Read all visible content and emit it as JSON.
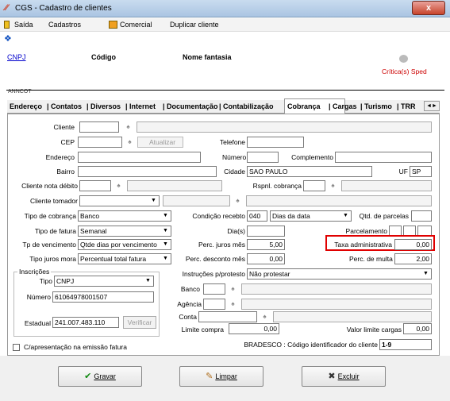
{
  "window": {
    "title": "CGS - Cadastro de clientes",
    "close": "x"
  },
  "menu": {
    "exit": "Saída",
    "cadastros": "Cadastros",
    "comercial": "Comercial",
    "duplicate": "Duplicar cliente"
  },
  "header": {
    "cnpj": "CNPJ",
    "codigo": "Código",
    "nome_fantasia": "Nome fantasia",
    "sped": "Crítica(s) Sped",
    "fragment": "ANNCOT"
  },
  "tabs": [
    "Endereço",
    "Contatos",
    "Diversos",
    "Internet",
    "Documentação",
    "Contabilização",
    "Cobrança",
    "Cargas",
    "Turismo",
    "TRR"
  ],
  "tab_arrows": "◄►",
  "form": {
    "cliente": "Cliente",
    "cep": "CEP",
    "atualizar": "Atualizar",
    "telefone": "Telefone",
    "endereco": "Endereço",
    "numero": "Número",
    "complemento": "Complemento",
    "bairro": "Bairro",
    "cidade": "Cidade",
    "cidade_val": "SAO PAULO",
    "uf": "UF",
    "uf_val": "SP",
    "cliente_nota": "Cliente nota débito",
    "rspnl": "Rspnl. cobrança",
    "cliente_tomador": "Cliente tomador",
    "tipo_cobranca": "Tipo de cobrança",
    "tipo_cobranca_val": "Banco",
    "cond_recebto": "Condição recebto",
    "cond_code": "040",
    "cond_val": "Dias da data",
    "qtd_parcelas": "Qtd. de parcelas",
    "tipo_fatura": "Tipo de fatura",
    "tipo_fatura_val": "Semanal",
    "dias": "Dia(s)",
    "parcelamento": "Parcelamento",
    "tp_venc": "Tp de vencimento",
    "tp_venc_val": "Qtde dias por vencimento",
    "perc_juros": "Perc. juros mês",
    "perc_juros_val": "5,00",
    "taxa_adm": "Taxa administrativa",
    "taxa_adm_val": "0,00",
    "tipo_juros": "Tipo juros mora",
    "tipo_juros_val": "Percentual total fatura",
    "perc_desc": "Perc. desconto mês",
    "perc_desc_val": "0,00",
    "perc_multa": "Perc. de multa",
    "perc_multa_val": "2,00",
    "inscricoes": "Inscrições",
    "tipo": "Tipo",
    "tipo_val": "CNPJ",
    "numero_insc": "Número",
    "numero_insc_val": "61064978001507",
    "instrucoes": "Instruções p/protesto",
    "instrucoes_val": "Não protestar",
    "banco": "Banco",
    "agencia": "Agência",
    "conta": "Conta",
    "estadual": "Estadual",
    "estadual_val": "241.007.483.110",
    "verificar": "Verificar",
    "limite": "Limite compra",
    "limite_val": "0,00",
    "valor_limite": "Valor limite cargas",
    "valor_limite_val": "0,00",
    "c_apresentacao": "C/apresentação na emissão fatura",
    "bradesco": "BRADESCO : Código identificador do cliente",
    "bradesco_val": "1-9"
  },
  "buttons": {
    "gravar": "Gravar",
    "limpar": "Limpar",
    "excluir": "Excluir"
  }
}
